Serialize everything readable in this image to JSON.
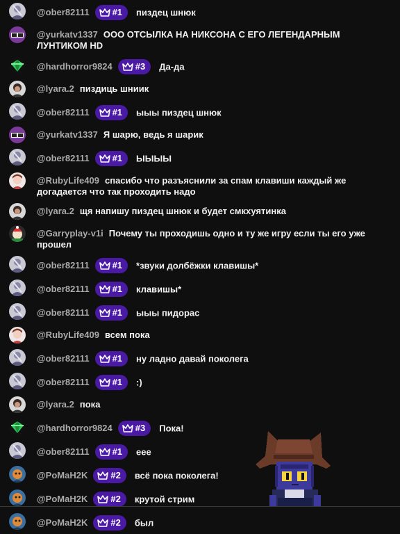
{
  "messages": [
    {
      "author": "@ober82111",
      "avatar": "ober",
      "badge": "#1",
      "text": "пиздец шнюк"
    },
    {
      "author": "@yurkatv1337",
      "avatar": "yurka",
      "badge": null,
      "text": "ООО ОТСЫЛКА НА НИКСОНА С ЕГО ЛЕГЕНДАРНЫМ ЛУНТИКОМ HD"
    },
    {
      "author": "@hardhorror9824",
      "avatar": "hard",
      "badge": "#3",
      "text": "Да-да"
    },
    {
      "author": "@lyara.2",
      "avatar": "lyara",
      "badge": null,
      "text": "пиздиць шниик"
    },
    {
      "author": "@ober82111",
      "avatar": "ober",
      "badge": "#1",
      "text": "ыыы пиздец шнюк"
    },
    {
      "author": "@yurkatv1337",
      "avatar": "yurka",
      "badge": null,
      "text": "Я шарю, ведь я шарик"
    },
    {
      "author": "@ober82111",
      "avatar": "ober",
      "badge": "#1",
      "text": "ЫЫЫЫ"
    },
    {
      "author": "@RubyLife409",
      "avatar": "ruby",
      "badge": null,
      "text": "спасибо что разъяснили за спам клавиши каждый же догадается что так проходить надо"
    },
    {
      "author": "@lyara.2",
      "avatar": "lyara",
      "badge": null,
      "text": "щя напишу пиздец шнюк и будет смкхуятинка"
    },
    {
      "author": "@Garryplay-v1i",
      "avatar": "garry",
      "badge": null,
      "text": "Почему ты проходишь одно и ту же игру если ты его уже прошел"
    },
    {
      "author": "@ober82111",
      "avatar": "ober",
      "badge": "#1",
      "text": "*звуки долбёжки клавишы*"
    },
    {
      "author": "@ober82111",
      "avatar": "ober",
      "badge": "#1",
      "text": "клавишы*"
    },
    {
      "author": "@ober82111",
      "avatar": "ober",
      "badge": "#1",
      "text": "ыыы пидорас"
    },
    {
      "author": "@RubyLife409",
      "avatar": "ruby",
      "badge": null,
      "text": "всем пока"
    },
    {
      "author": "@ober82111",
      "avatar": "ober",
      "badge": "#1",
      "text": "ну ладно давай поколега"
    },
    {
      "author": "@ober82111",
      "avatar": "ober",
      "badge": "#1",
      "text": ":)"
    },
    {
      "author": "@lyara.2",
      "avatar": "lyara",
      "badge": null,
      "text": "пока"
    },
    {
      "author": "@hardhorror9824",
      "avatar": "hard",
      "badge": "#3",
      "text": "Пока!"
    },
    {
      "author": "@ober82111",
      "avatar": "ober",
      "badge": "#1",
      "text": "еее"
    },
    {
      "author": "@PoMaH2K",
      "avatar": "pomah",
      "badge": "#2",
      "text": "всё пока поколега!"
    },
    {
      "author": "@PoMaH2K",
      "avatar": "pomah",
      "badge": "#2",
      "text": "крутой стрим"
    },
    {
      "author": "@PoMaH2K",
      "avatar": "pomah",
      "badge": "#2",
      "text": "был"
    }
  ],
  "colors": {
    "background": "#0f0f0f",
    "author": "#aaaaaa",
    "text": "#f1f1f1",
    "badge": "#4b1aa5"
  },
  "icons": {
    "badge": "crown-icon",
    "overlay": "niko-sprite"
  }
}
